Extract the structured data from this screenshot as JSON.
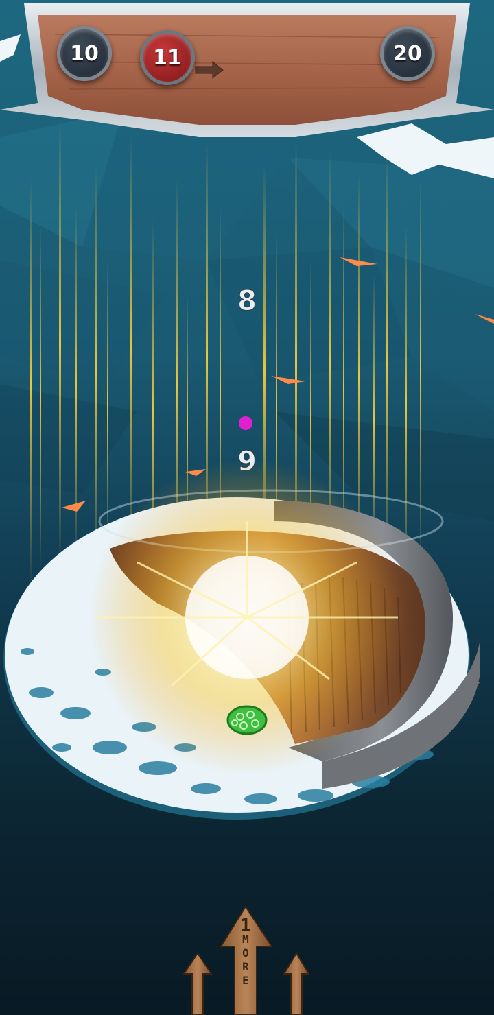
{
  "level_progress": {
    "previous_level": "10",
    "current_level": "11",
    "next_level": "20"
  },
  "platform_numbers": [
    "8",
    "9"
  ],
  "bottom_hint": {
    "count": "1",
    "letters": [
      "M",
      "O",
      "R",
      "E"
    ]
  },
  "colors": {
    "ice": "#2a6d86",
    "banner_wood": "#a9684f",
    "current_badge": "#b52a2c",
    "badge_dark": "#2b3440",
    "glow": "#ffd23a",
    "ball": "#3fbf3f",
    "marker_dot": "#e01fd0"
  }
}
